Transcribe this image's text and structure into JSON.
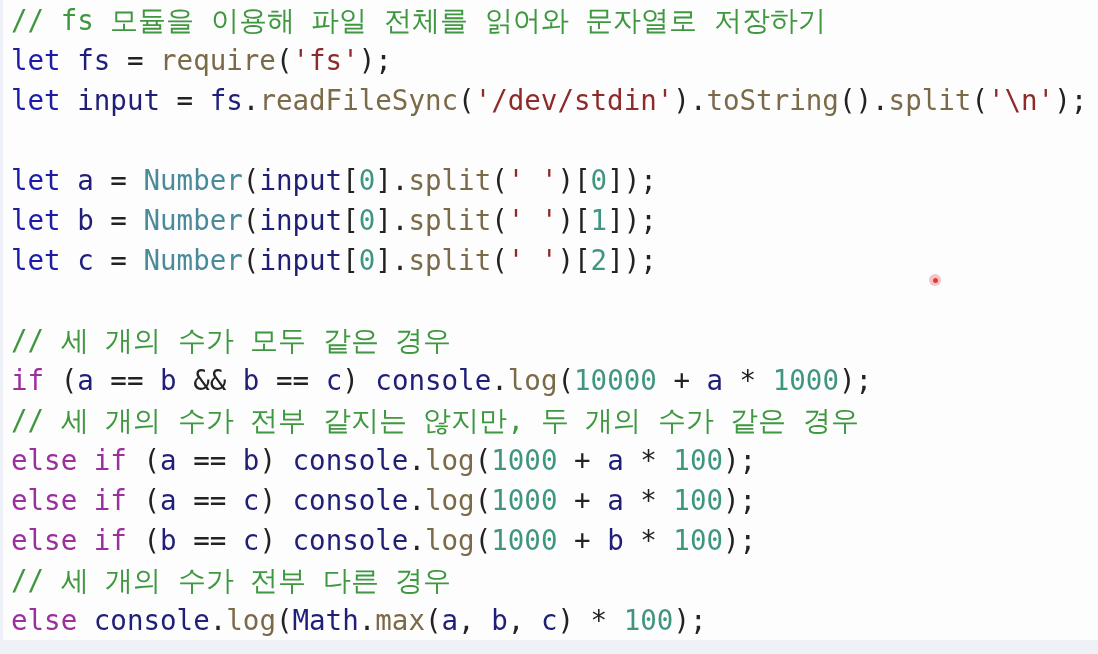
{
  "editor": {
    "lines": [
      {
        "kind": "code",
        "tokens": [
          {
            "kind": "comment",
            "text": "// fs 모듈을 이용해 파일 전체를 읽어와 문자열로 저장하기"
          }
        ]
      },
      {
        "kind": "code",
        "tokens": [
          {
            "kind": "keyword",
            "text": "let "
          },
          {
            "kind": "variable",
            "text": "fs"
          },
          {
            "kind": "plain",
            "text": " = "
          },
          {
            "kind": "method",
            "text": "require"
          },
          {
            "kind": "plain",
            "text": "("
          },
          {
            "kind": "string",
            "text": "'fs'"
          },
          {
            "kind": "plain",
            "text": ");"
          }
        ]
      },
      {
        "kind": "code",
        "tokens": [
          {
            "kind": "keyword",
            "text": "let "
          },
          {
            "kind": "variable",
            "text": "input"
          },
          {
            "kind": "plain",
            "text": " = "
          },
          {
            "kind": "variable",
            "text": "fs"
          },
          {
            "kind": "plain",
            "text": "."
          },
          {
            "kind": "method",
            "text": "readFileSync"
          },
          {
            "kind": "plain",
            "text": "("
          },
          {
            "kind": "string",
            "text": "'/dev/stdin'"
          },
          {
            "kind": "plain",
            "text": ")."
          },
          {
            "kind": "method",
            "text": "toString"
          },
          {
            "kind": "plain",
            "text": "()."
          },
          {
            "kind": "method",
            "text": "split"
          },
          {
            "kind": "plain",
            "text": "("
          },
          {
            "kind": "string",
            "text": "'\\n'"
          },
          {
            "kind": "plain",
            "text": ");"
          }
        ]
      },
      {
        "kind": "blank"
      },
      {
        "kind": "code",
        "tokens": [
          {
            "kind": "keyword",
            "text": "let "
          },
          {
            "kind": "variable",
            "text": "a"
          },
          {
            "kind": "plain",
            "text": " = "
          },
          {
            "kind": "class",
            "text": "Number"
          },
          {
            "kind": "plain",
            "text": "("
          },
          {
            "kind": "variable",
            "text": "input"
          },
          {
            "kind": "plain",
            "text": "["
          },
          {
            "kind": "number",
            "text": "0"
          },
          {
            "kind": "plain",
            "text": "]."
          },
          {
            "kind": "method",
            "text": "split"
          },
          {
            "kind": "plain",
            "text": "("
          },
          {
            "kind": "string",
            "text": "' '"
          },
          {
            "kind": "plain",
            "text": ")["
          },
          {
            "kind": "number",
            "text": "0"
          },
          {
            "kind": "plain",
            "text": "]);"
          }
        ]
      },
      {
        "kind": "code",
        "tokens": [
          {
            "kind": "keyword",
            "text": "let "
          },
          {
            "kind": "variable",
            "text": "b"
          },
          {
            "kind": "plain",
            "text": " = "
          },
          {
            "kind": "class",
            "text": "Number"
          },
          {
            "kind": "plain",
            "text": "("
          },
          {
            "kind": "variable",
            "text": "input"
          },
          {
            "kind": "plain",
            "text": "["
          },
          {
            "kind": "number",
            "text": "0"
          },
          {
            "kind": "plain",
            "text": "]."
          },
          {
            "kind": "method",
            "text": "split"
          },
          {
            "kind": "plain",
            "text": "("
          },
          {
            "kind": "string",
            "text": "' '"
          },
          {
            "kind": "plain",
            "text": ")["
          },
          {
            "kind": "number",
            "text": "1"
          },
          {
            "kind": "plain",
            "text": "]);"
          }
        ]
      },
      {
        "kind": "code",
        "tokens": [
          {
            "kind": "keyword",
            "text": "let "
          },
          {
            "kind": "variable",
            "text": "c"
          },
          {
            "kind": "plain",
            "text": " = "
          },
          {
            "kind": "class",
            "text": "Number"
          },
          {
            "kind": "plain",
            "text": "("
          },
          {
            "kind": "variable",
            "text": "input"
          },
          {
            "kind": "plain",
            "text": "["
          },
          {
            "kind": "number",
            "text": "0"
          },
          {
            "kind": "plain",
            "text": "]."
          },
          {
            "kind": "method",
            "text": "split"
          },
          {
            "kind": "plain",
            "text": "("
          },
          {
            "kind": "string",
            "text": "' '"
          },
          {
            "kind": "plain",
            "text": ")["
          },
          {
            "kind": "number",
            "text": "2"
          },
          {
            "kind": "plain",
            "text": "]);"
          }
        ]
      },
      {
        "kind": "blank"
      },
      {
        "kind": "code",
        "tokens": [
          {
            "kind": "comment",
            "text": "// 세 개의 수가 모두 같은 경우"
          }
        ]
      },
      {
        "kind": "code",
        "tokens": [
          {
            "kind": "control",
            "text": "if"
          },
          {
            "kind": "plain",
            "text": " ("
          },
          {
            "kind": "variable",
            "text": "a"
          },
          {
            "kind": "plain",
            "text": " == "
          },
          {
            "kind": "variable",
            "text": "b"
          },
          {
            "kind": "plain",
            "text": " && "
          },
          {
            "kind": "variable",
            "text": "b"
          },
          {
            "kind": "plain",
            "text": " == "
          },
          {
            "kind": "variable",
            "text": "c"
          },
          {
            "kind": "plain",
            "text": ") "
          },
          {
            "kind": "variable",
            "text": "console"
          },
          {
            "kind": "plain",
            "text": "."
          },
          {
            "kind": "method",
            "text": "log"
          },
          {
            "kind": "plain",
            "text": "("
          },
          {
            "kind": "number",
            "text": "10000"
          },
          {
            "kind": "plain",
            "text": " + "
          },
          {
            "kind": "variable",
            "text": "a"
          },
          {
            "kind": "plain",
            "text": " * "
          },
          {
            "kind": "number",
            "text": "1000"
          },
          {
            "kind": "plain",
            "text": ");"
          }
        ]
      },
      {
        "kind": "code",
        "tokens": [
          {
            "kind": "comment",
            "text": "// 세 개의 수가 전부 같지는 않지만, 두 개의 수가 같은 경우"
          }
        ]
      },
      {
        "kind": "code",
        "tokens": [
          {
            "kind": "control",
            "text": "else if"
          },
          {
            "kind": "plain",
            "text": " ("
          },
          {
            "kind": "variable",
            "text": "a"
          },
          {
            "kind": "plain",
            "text": " == "
          },
          {
            "kind": "variable",
            "text": "b"
          },
          {
            "kind": "plain",
            "text": ") "
          },
          {
            "kind": "variable",
            "text": "console"
          },
          {
            "kind": "plain",
            "text": "."
          },
          {
            "kind": "method",
            "text": "log"
          },
          {
            "kind": "plain",
            "text": "("
          },
          {
            "kind": "number",
            "text": "1000"
          },
          {
            "kind": "plain",
            "text": " + "
          },
          {
            "kind": "variable",
            "text": "a"
          },
          {
            "kind": "plain",
            "text": " * "
          },
          {
            "kind": "number",
            "text": "100"
          },
          {
            "kind": "plain",
            "text": ");"
          }
        ]
      },
      {
        "kind": "code",
        "tokens": [
          {
            "kind": "control",
            "text": "else if"
          },
          {
            "kind": "plain",
            "text": " ("
          },
          {
            "kind": "variable",
            "text": "a"
          },
          {
            "kind": "plain",
            "text": " == "
          },
          {
            "kind": "variable",
            "text": "c"
          },
          {
            "kind": "plain",
            "text": ") "
          },
          {
            "kind": "variable",
            "text": "console"
          },
          {
            "kind": "plain",
            "text": "."
          },
          {
            "kind": "method",
            "text": "log"
          },
          {
            "kind": "plain",
            "text": "("
          },
          {
            "kind": "number",
            "text": "1000"
          },
          {
            "kind": "plain",
            "text": " + "
          },
          {
            "kind": "variable",
            "text": "a"
          },
          {
            "kind": "plain",
            "text": " * "
          },
          {
            "kind": "number",
            "text": "100"
          },
          {
            "kind": "plain",
            "text": ");"
          }
        ]
      },
      {
        "kind": "code",
        "tokens": [
          {
            "kind": "control",
            "text": "else if"
          },
          {
            "kind": "plain",
            "text": " ("
          },
          {
            "kind": "variable",
            "text": "b"
          },
          {
            "kind": "plain",
            "text": " == "
          },
          {
            "kind": "variable",
            "text": "c"
          },
          {
            "kind": "plain",
            "text": ") "
          },
          {
            "kind": "variable",
            "text": "console"
          },
          {
            "kind": "plain",
            "text": "."
          },
          {
            "kind": "method",
            "text": "log"
          },
          {
            "kind": "plain",
            "text": "("
          },
          {
            "kind": "number",
            "text": "1000"
          },
          {
            "kind": "plain",
            "text": " + "
          },
          {
            "kind": "variable",
            "text": "b"
          },
          {
            "kind": "plain",
            "text": " * "
          },
          {
            "kind": "number",
            "text": "100"
          },
          {
            "kind": "plain",
            "text": ");"
          }
        ]
      },
      {
        "kind": "code",
        "tokens": [
          {
            "kind": "comment",
            "text": "// 세 개의 수가 전부 다른 경우"
          }
        ]
      },
      {
        "kind": "code",
        "tokens": [
          {
            "kind": "control",
            "text": "else "
          },
          {
            "kind": "variable",
            "text": "console"
          },
          {
            "kind": "plain",
            "text": "."
          },
          {
            "kind": "method",
            "text": "log"
          },
          {
            "kind": "plain",
            "text": "("
          },
          {
            "kind": "variable",
            "text": "Math"
          },
          {
            "kind": "plain",
            "text": "."
          },
          {
            "kind": "method",
            "text": "max"
          },
          {
            "kind": "plain",
            "text": "("
          },
          {
            "kind": "variable",
            "text": "a"
          },
          {
            "kind": "plain",
            "text": ", "
          },
          {
            "kind": "variable",
            "text": "b"
          },
          {
            "kind": "plain",
            "text": ", "
          },
          {
            "kind": "variable",
            "text": "c"
          },
          {
            "kind": "plain",
            "text": ") * "
          },
          {
            "kind": "number",
            "text": "100"
          },
          {
            "kind": "plain",
            "text": ");"
          }
        ]
      }
    ]
  }
}
